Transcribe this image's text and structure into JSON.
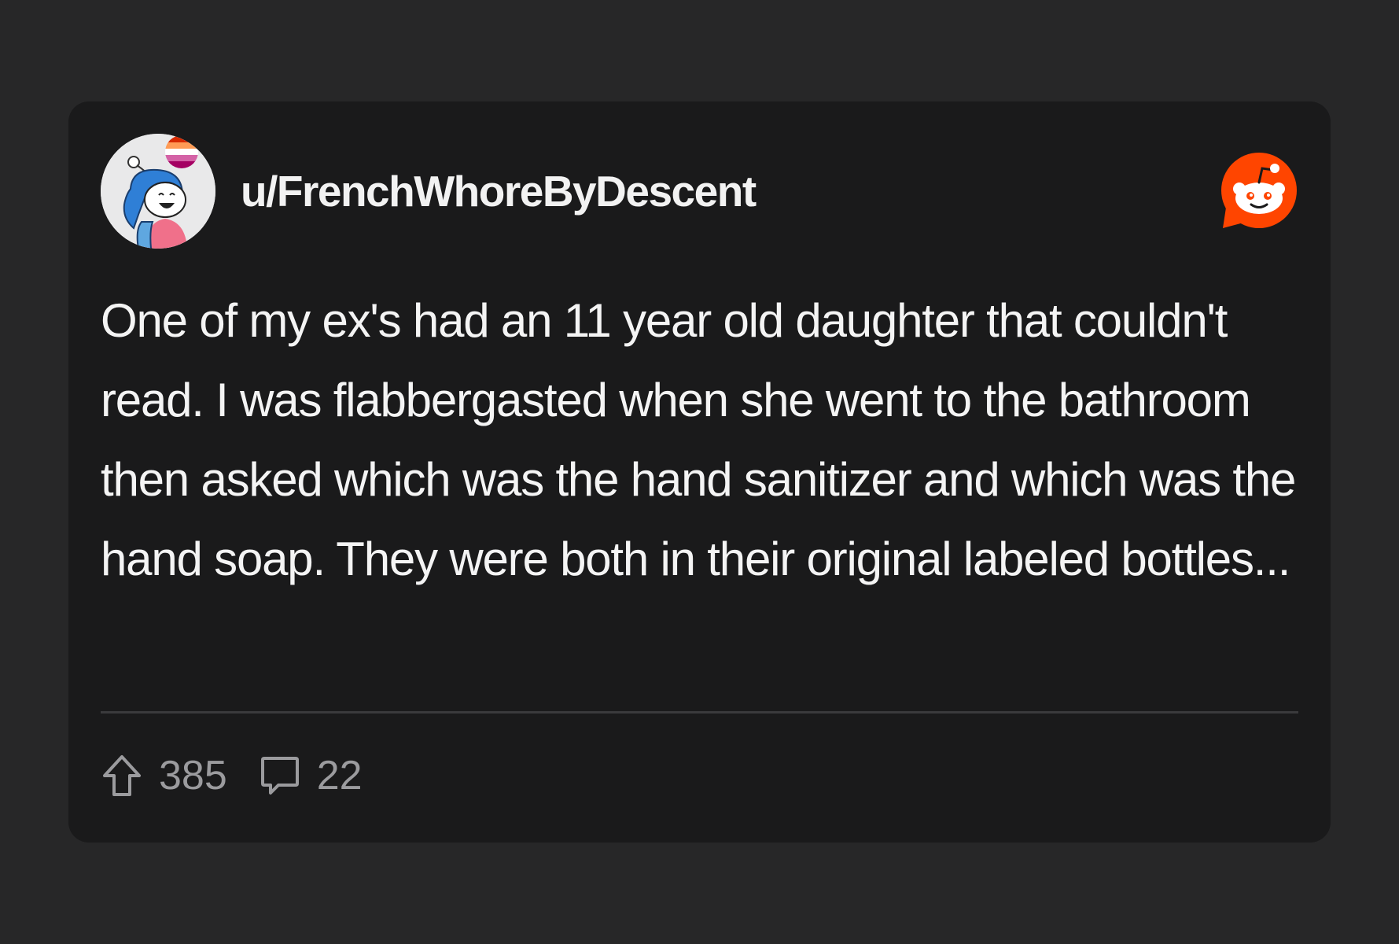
{
  "post": {
    "username": "u/FrenchWhoreByDescent",
    "body": "One of my ex's had an 11 year old daughter that couldn't read. I was flabbergasted when she went to the bathroom then asked which was the hand sanitizer and which was the hand soap. They were both in their original labeled bottles...",
    "upvotes": "385",
    "comments": "22"
  },
  "icons": {
    "avatar": "snoo-avatar",
    "logo": "reddit-logo-icon",
    "upvote": "upvote-arrow-icon",
    "comment": "comment-bubble-icon"
  },
  "colors": {
    "page_background": "#272728",
    "card_background": "#1a1a1b",
    "reddit_orange": "#ff4500",
    "text_primary": "#f4f4f4",
    "text_muted": "#9b9b9e"
  }
}
